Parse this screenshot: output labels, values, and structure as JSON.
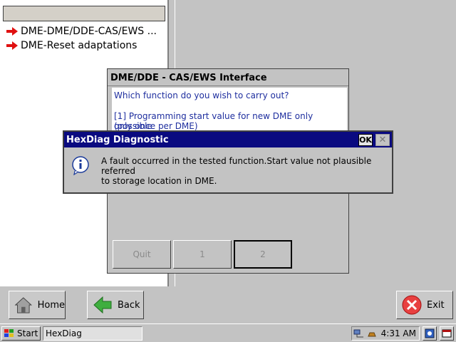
{
  "left_panel": {
    "items": [
      {
        "label": "DME-DME/DDE-CAS/EWS ...",
        "icon": "red-arrow-icon"
      },
      {
        "label": "DME-Reset adaptations",
        "icon": "red-arrow-icon"
      }
    ]
  },
  "bottom_bar": {
    "home_label": "Home",
    "back_label": "Back",
    "exit_label": "Exit"
  },
  "dme_window": {
    "title": "DME/DDE - CAS/EWS Interface",
    "question": "Which function do you wish to carry out?",
    "option_1_line1": "[1]  Programming start value for new DME only (possible",
    "option_1_line2": "only once per DME)",
    "buttons": {
      "quit": "Quit",
      "one": "1",
      "two": "2"
    }
  },
  "dialog": {
    "title": "HexDiag Diagnostic",
    "ok_label": "OK",
    "close_label": "✕",
    "message_line1": "A fault occurred in the tested function.Start value not plausible referred",
    "message_line2": "to storage location in DME.",
    "icon": "info-icon"
  },
  "taskbar": {
    "start_label": "Start",
    "task_label": "HexDiag",
    "clock": "4:31 AM"
  },
  "colors": {
    "dialog_title_bg": "#0a0a80",
    "dme_text": "#1f2f9f",
    "arrow": "#e01010"
  }
}
